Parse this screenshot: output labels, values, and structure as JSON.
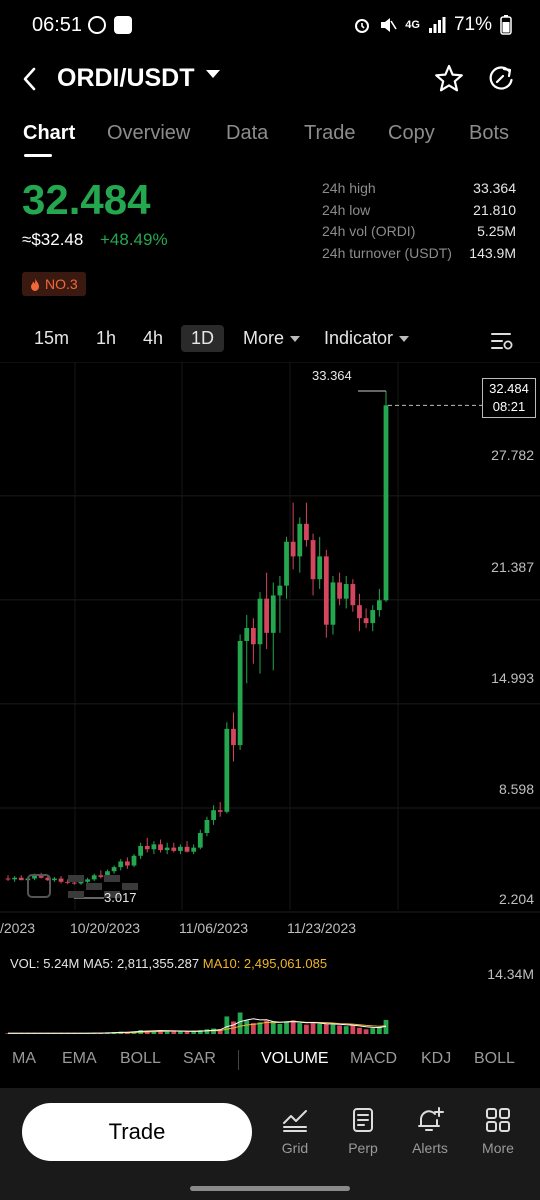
{
  "status_bar": {
    "time": "06:51",
    "network": "4G",
    "battery": "71%"
  },
  "header": {
    "pair": "ORDI/USDT"
  },
  "tabs": [
    "Chart",
    "Overview",
    "Data",
    "Trade",
    "Copy",
    "Bots"
  ],
  "ticker": {
    "last_price": "32.484",
    "fiat_price": "≈$32.48",
    "change": "+48.49%",
    "rank": "NO.3",
    "stats": [
      {
        "label": "24h high",
        "value": "33.364"
      },
      {
        "label": "24h low",
        "value": "21.810"
      },
      {
        "label": "24h vol (ORDI)",
        "value": "5.25M"
      },
      {
        "label": "24h turnover (USDT)",
        "value": "143.9M"
      }
    ]
  },
  "intervals": {
    "items": [
      "15m",
      "1h",
      "4h",
      "1D"
    ],
    "selected": "1D",
    "more": "More",
    "indicator": "Indicator"
  },
  "chart_data": {
    "type": "candlestick",
    "y_ticks": [
      "27.782",
      "21.387",
      "14.993",
      "8.598",
      "2.204"
    ],
    "x_ticks": [
      "/2023",
      "10/20/2023",
      "11/06/2023",
      "11/23/2023"
    ],
    "ylim": [
      2.204,
      33.364
    ],
    "high_label": "33.364",
    "low_label": "3.017",
    "current_price": "32.484",
    "countdown": "08:21",
    "colors": {
      "up": "#25a750",
      "down": "#d4455e"
    },
    "candles": [
      {
        "o": 3.4,
        "h": 3.6,
        "l": 3.25,
        "c": 3.35
      },
      {
        "o": 3.35,
        "h": 3.55,
        "l": 3.2,
        "c": 3.45
      },
      {
        "o": 3.45,
        "h": 3.6,
        "l": 3.3,
        "c": 3.3
      },
      {
        "o": 3.3,
        "h": 3.5,
        "l": 3.15,
        "c": 3.4
      },
      {
        "o": 3.4,
        "h": 3.7,
        "l": 3.3,
        "c": 3.6
      },
      {
        "o": 3.6,
        "h": 3.75,
        "l": 3.4,
        "c": 3.45
      },
      {
        "o": 3.45,
        "h": 3.6,
        "l": 3.25,
        "c": 3.3
      },
      {
        "o": 3.3,
        "h": 3.5,
        "l": 3.2,
        "c": 3.4
      },
      {
        "o": 3.4,
        "h": 3.55,
        "l": 3.1,
        "c": 3.2
      },
      {
        "o": 3.2,
        "h": 3.35,
        "l": 3.05,
        "c": 3.15
      },
      {
        "o": 3.15,
        "h": 3.3,
        "l": 3.02,
        "c": 3.1
      },
      {
        "o": 3.1,
        "h": 3.25,
        "l": 3.017,
        "c": 3.2
      },
      {
        "o": 3.2,
        "h": 3.45,
        "l": 3.1,
        "c": 3.35
      },
      {
        "o": 3.35,
        "h": 3.7,
        "l": 3.25,
        "c": 3.6
      },
      {
        "o": 3.6,
        "h": 3.9,
        "l": 3.4,
        "c": 3.5
      },
      {
        "o": 3.5,
        "h": 3.95,
        "l": 3.4,
        "c": 3.85
      },
      {
        "o": 3.85,
        "h": 4.2,
        "l": 3.7,
        "c": 4.1
      },
      {
        "o": 4.1,
        "h": 4.6,
        "l": 3.9,
        "c": 4.45
      },
      {
        "o": 4.45,
        "h": 4.7,
        "l": 4.0,
        "c": 4.2
      },
      {
        "o": 4.2,
        "h": 4.9,
        "l": 4.1,
        "c": 4.8
      },
      {
        "o": 4.8,
        "h": 5.6,
        "l": 4.6,
        "c": 5.4
      },
      {
        "o": 5.4,
        "h": 5.9,
        "l": 5.0,
        "c": 5.2
      },
      {
        "o": 5.2,
        "h": 5.7,
        "l": 4.9,
        "c": 5.5
      },
      {
        "o": 5.5,
        "h": 5.8,
        "l": 5.0,
        "c": 5.15
      },
      {
        "o": 5.15,
        "h": 5.6,
        "l": 4.9,
        "c": 5.3
      },
      {
        "o": 5.3,
        "h": 5.6,
        "l": 5.0,
        "c": 5.1
      },
      {
        "o": 5.1,
        "h": 5.5,
        "l": 4.9,
        "c": 5.35
      },
      {
        "o": 5.35,
        "h": 5.7,
        "l": 5.0,
        "c": 5.05
      },
      {
        "o": 5.05,
        "h": 5.5,
        "l": 4.9,
        "c": 5.3
      },
      {
        "o": 5.3,
        "h": 6.4,
        "l": 5.2,
        "c": 6.2
      },
      {
        "o": 6.2,
        "h": 7.2,
        "l": 6.0,
        "c": 7.0
      },
      {
        "o": 7.0,
        "h": 7.9,
        "l": 6.7,
        "c": 7.6
      },
      {
        "o": 7.6,
        "h": 8.1,
        "l": 7.2,
        "c": 7.5
      },
      {
        "o": 7.5,
        "h": 13.0,
        "l": 7.4,
        "c": 12.6
      },
      {
        "o": 12.6,
        "h": 13.6,
        "l": 10.6,
        "c": 11.6
      },
      {
        "o": 11.6,
        "h": 18.4,
        "l": 11.3,
        "c": 18.0
      },
      {
        "o": 18.0,
        "h": 19.6,
        "l": 15.4,
        "c": 18.8
      },
      {
        "o": 18.8,
        "h": 19.4,
        "l": 16.6,
        "c": 17.8
      },
      {
        "o": 17.8,
        "h": 21.0,
        "l": 16.0,
        "c": 20.6
      },
      {
        "o": 20.6,
        "h": 22.2,
        "l": 17.5,
        "c": 18.5
      },
      {
        "o": 18.5,
        "h": 21.6,
        "l": 16.2,
        "c": 20.8
      },
      {
        "o": 20.8,
        "h": 22.0,
        "l": 18.5,
        "c": 21.4
      },
      {
        "o": 21.4,
        "h": 24.4,
        "l": 20.6,
        "c": 24.1
      },
      {
        "o": 24.1,
        "h": 26.5,
        "l": 22.4,
        "c": 23.2
      },
      {
        "o": 23.2,
        "h": 25.6,
        "l": 22.2,
        "c": 25.2
      },
      {
        "o": 25.2,
        "h": 26.5,
        "l": 23.8,
        "c": 24.2
      },
      {
        "o": 24.2,
        "h": 24.6,
        "l": 20.8,
        "c": 21.8
      },
      {
        "o": 21.8,
        "h": 24.4,
        "l": 21.2,
        "c": 23.2
      },
      {
        "o": 23.2,
        "h": 23.6,
        "l": 18.2,
        "c": 19.0
      },
      {
        "o": 19.0,
        "h": 22.0,
        "l": 18.4,
        "c": 21.6
      },
      {
        "o": 21.6,
        "h": 22.2,
        "l": 20.2,
        "c": 20.6
      },
      {
        "o": 20.6,
        "h": 22.0,
        "l": 20.0,
        "c": 21.5
      },
      {
        "o": 21.5,
        "h": 21.8,
        "l": 19.8,
        "c": 20.2
      },
      {
        "o": 20.2,
        "h": 20.9,
        "l": 18.6,
        "c": 19.4
      },
      {
        "o": 19.4,
        "h": 20.0,
        "l": 18.8,
        "c": 19.1
      },
      {
        "o": 19.1,
        "h": 20.2,
        "l": 18.6,
        "c": 19.9
      },
      {
        "o": 19.9,
        "h": 21.2,
        "l": 19.5,
        "c": 20.5
      },
      {
        "o": 20.5,
        "h": 33.364,
        "l": 20.4,
        "c": 32.484
      }
    ]
  },
  "volume": {
    "vol_label": "VOL: 5.24M",
    "ma5_label": "MA5: 2,811,355.287",
    "ma10_label": "MA10: 2,495,061.085",
    "max_tick": "14.34M",
    "max_value": 14.34,
    "unit": "M",
    "bars": [
      0.2,
      0.2,
      0.2,
      0.2,
      0.25,
      0.2,
      0.2,
      0.2,
      0.2,
      0.2,
      0.2,
      0.2,
      0.2,
      0.3,
      0.3,
      0.4,
      0.5,
      0.6,
      0.5,
      0.7,
      1.0,
      0.9,
      0.9,
      0.8,
      0.7,
      0.7,
      0.7,
      0.6,
      0.6,
      1.0,
      1.2,
      1.4,
      1.2,
      4.5,
      3.2,
      5.5,
      3.5,
      2.8,
      3.0,
      3.4,
      3.2,
      2.6,
      3.2,
      3.5,
      2.8,
      2.4,
      2.8,
      2.6,
      2.6,
      2.4,
      2.2,
      2.0,
      2.2,
      1.6,
      1.2,
      1.5,
      1.8,
      3.6
    ],
    "ma5": [
      0.2,
      0.2,
      0.2,
      0.2,
      0.21,
      0.21,
      0.21,
      0.21,
      0.21,
      0.2,
      0.2,
      0.2,
      0.2,
      0.22,
      0.24,
      0.28,
      0.34,
      0.42,
      0.46,
      0.54,
      0.66,
      0.74,
      0.8,
      0.86,
      0.84,
      0.8,
      0.76,
      0.7,
      0.66,
      0.72,
      0.82,
      0.96,
      1.08,
      1.86,
      2.3,
      3.16,
      3.58,
      3.9,
      3.6,
      3.64,
      3.18,
      3.0,
      3.08,
      3.18,
      3.06,
      2.9,
      2.94,
      2.8,
      2.64,
      2.56,
      2.52,
      2.36,
      2.28,
      2.08,
      1.84,
      1.7,
      1.66,
      1.94
    ],
    "ma10": [
      0.2,
      0.2,
      0.2,
      0.2,
      0.2,
      0.2,
      0.2,
      0.2,
      0.2,
      0.2,
      0.2,
      0.2,
      0.2,
      0.21,
      0.22,
      0.24,
      0.27,
      0.31,
      0.34,
      0.39,
      0.46,
      0.53,
      0.6,
      0.66,
      0.71,
      0.73,
      0.75,
      0.75,
      0.76,
      0.77,
      0.79,
      0.84,
      0.88,
      1.26,
      1.54,
      2.01,
      2.3,
      2.47,
      2.7,
      2.98,
      2.87,
      3.0,
      3.14,
      3.26,
      3.14,
      2.97,
      2.97,
      2.94,
      2.92,
      2.82,
      2.67,
      2.62,
      2.53,
      2.37,
      2.2,
      2.08,
      1.98,
      2.12
    ],
    "colors": {
      "ma5": "#ffffff",
      "ma10": "#f0b429",
      "up": "#25a750",
      "down": "#d4455e"
    }
  },
  "indicators": {
    "main": [
      "MA",
      "EMA",
      "BOLL",
      "SAR"
    ],
    "sub": [
      "VOLUME",
      "MACD",
      "KDJ",
      "BOLL"
    ],
    "active": "VOLUME"
  },
  "bottom_nav": {
    "trade": "Trade",
    "items": [
      {
        "label": "Grid",
        "icon": "grid-chart-icon"
      },
      {
        "label": "Perp",
        "icon": "document-icon"
      },
      {
        "label": "Alerts",
        "icon": "bell-plus-icon"
      },
      {
        "label": "More",
        "icon": "four-squares-icon"
      }
    ]
  }
}
